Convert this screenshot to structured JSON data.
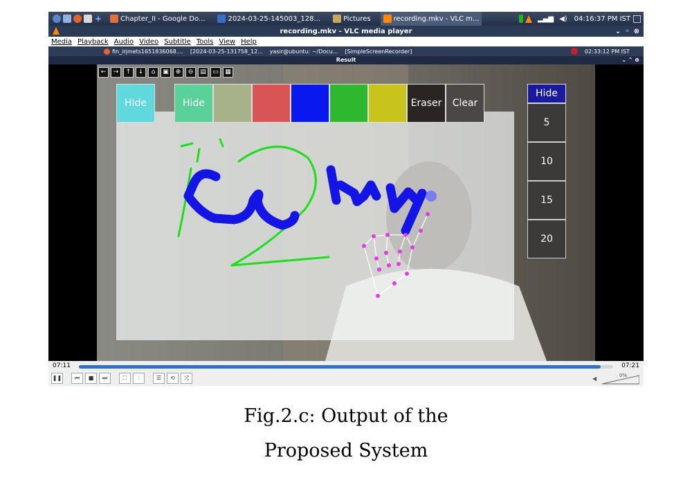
{
  "outer_taskbar": {
    "items": [
      {
        "label": "Chapter_II - Google Do...",
        "color": "#e2703a"
      },
      {
        "label": "2024-03-25-145003_128...",
        "color": "#3a6ec8"
      },
      {
        "label": "Pictures",
        "color": "#c9a75a"
      },
      {
        "label": "recording.mkv - VLC m...",
        "color": "#ff8800",
        "active": true
      }
    ],
    "clock": "04:16:37 PM IST"
  },
  "window": {
    "title": "recording.mkv - VLC media player"
  },
  "menu": [
    "Media",
    "Playback",
    "Audio",
    "Video",
    "Subtitle",
    "Tools",
    "View",
    "Help"
  ],
  "inner_taskbar": {
    "items": [
      "fin_irjmets1651836068....",
      "[2024-03-25-131758_12...",
      "yasir@ubuntu: ~/Docu...",
      "[SimpleScreenRecorder]"
    ],
    "clock": "02:33:12 PM IST"
  },
  "inner_window": {
    "title": "Result"
  },
  "toolbar_icons": [
    "arrow-left-icon",
    "arrow-right-icon",
    "arrow-up-icon",
    "arrow-down-icon",
    "home-icon",
    "save-icon",
    "zoom-in-icon",
    "zoom-out-icon",
    "save-as-icon",
    "copy-icon",
    "clipboard-icon"
  ],
  "palette": [
    {
      "label": "Hide",
      "color": "#5fd9dc"
    },
    {
      "label": "",
      "color": "transparent"
    },
    {
      "label": "Hide",
      "color": "#5bd19a"
    },
    {
      "label": "",
      "color": "#a8b28a"
    },
    {
      "label": "",
      "color": "#d95555"
    },
    {
      "label": "",
      "color": "#0a18f0"
    },
    {
      "label": "",
      "color": "#2fb82f"
    },
    {
      "label": "",
      "color": "#c9c41c"
    },
    {
      "label": "Eraser",
      "color": "#2a2522"
    },
    {
      "label": "Clear",
      "color": "#4a4744"
    }
  ],
  "sizes": {
    "hide_label": "Hide",
    "values": [
      "5",
      "10",
      "15",
      "20"
    ]
  },
  "player": {
    "time_elapsed": "07:11",
    "time_total": "07:21",
    "progress": 0.977,
    "volume": "0%"
  },
  "caption": {
    "line1": "Fig.2.c: Output of the",
    "line2": "Proposed System"
  }
}
